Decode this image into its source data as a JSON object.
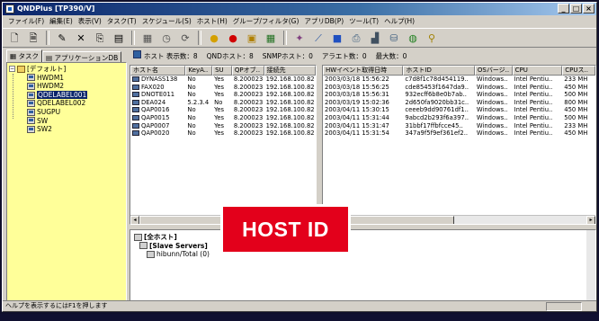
{
  "title": "QNDPlus [TP390/V]",
  "menu": [
    "ファイル(F)",
    "編集(E)",
    "表示(V)",
    "タスク(T)",
    "スケジュール(S)",
    "ホスト(H)",
    "グループ/フィルタ(G)",
    "アプリDB(P)",
    "ツール(T)",
    "ヘルプ(H)"
  ],
  "tabs": [
    "タスク",
    "アプリケーションDB"
  ],
  "tree": {
    "root": "[デフォルト]",
    "items": [
      "HWDM1",
      "HWDM2",
      "QDELABEL001",
      "QDELABEL002",
      "SUGPU",
      "SW",
      "SW2"
    ]
  },
  "status": {
    "host": "ホスト 表示数：8",
    "qnd": "QNDホスト：8",
    "snmp": "SNMPホスト：0",
    "alert": "アラエト数：0",
    "max": "最大数：0"
  },
  "list1": {
    "headers": [
      "ホスト名",
      "KeyA..",
      "SU",
      "QPオブ..",
      "接続先"
    ],
    "rows": [
      [
        "DYNASS138",
        "No",
        "Yes",
        "8.200023",
        "192.168.100.82"
      ],
      [
        "FAX020",
        "No",
        "Yes",
        "8.200023",
        "192.168.100.82"
      ],
      [
        "DNOTE011",
        "No",
        "Yes",
        "8.200023",
        "192.168.100.82"
      ],
      [
        "DEA024",
        "5.2.3.4",
        "No",
        "8.200023",
        "192.168.100.82"
      ],
      [
        "QAP0016",
        "No",
        "Yes",
        "8.200023",
        "192.168.100.82"
      ],
      [
        "QAP0015",
        "No",
        "Yes",
        "8.200023",
        "192.168.100.82"
      ],
      [
        "QAP0007",
        "No",
        "Yes",
        "8.200023",
        "192.168.100.82"
      ],
      [
        "QAP0020",
        "No",
        "Yes",
        "8.200023",
        "192.168.100.82"
      ]
    ]
  },
  "list2": {
    "headers": [
      "HWイベント取得日時",
      "ホストID",
      "OSバージ..",
      "CPU",
      "CPUス.."
    ],
    "rows": [
      [
        "2003/03/18 15:56:22",
        "c7d8f1c78d454119..",
        "Windows..",
        "Intel Pentiu..",
        "233 MH"
      ],
      [
        "2003/03/18 15:56:25",
        "cde85453f1647da9..",
        "Windows..",
        "Intel Pentiu..",
        "450 MH"
      ],
      [
        "2003/03/18 15:56:31",
        "932ecff6b8e0b7ab..",
        "Windows..",
        "Intel Pentiu..",
        "500 MH"
      ],
      [
        "2003/03/19 15:02:36",
        "2d650fa9020bb31c..",
        "Windows..",
        "Intel Pentiu..",
        "800 MH"
      ],
      [
        "2003/04/11 15:30:15",
        "ceeeb9dd90761df1..",
        "Windows..",
        "Intel Pentiu..",
        "450 MH"
      ],
      [
        "2003/04/11 15:31:44",
        "9abcd2b293f6a397..",
        "Windows..",
        "Intel Pentiu..",
        "500 MH"
      ],
      [
        "2003/04/11 15:31:47",
        "31bbf17ffbfcce45..",
        "Windows..",
        "Intel Pentiu..",
        "233 MH"
      ],
      [
        "2003/04/11 15:31:54",
        "347a9f5f9ef361ef2..",
        "Windows..",
        "Intel Pentiu..",
        "450 MH"
      ]
    ]
  },
  "bottom": {
    "all_hosts": "[全ホスト]",
    "slave": "[Slave Servers]",
    "hibunn": "hibunn/Total (0)"
  },
  "statusbar": "ヘルプを表示するにはF1を押します",
  "overlay": "HOST ID"
}
